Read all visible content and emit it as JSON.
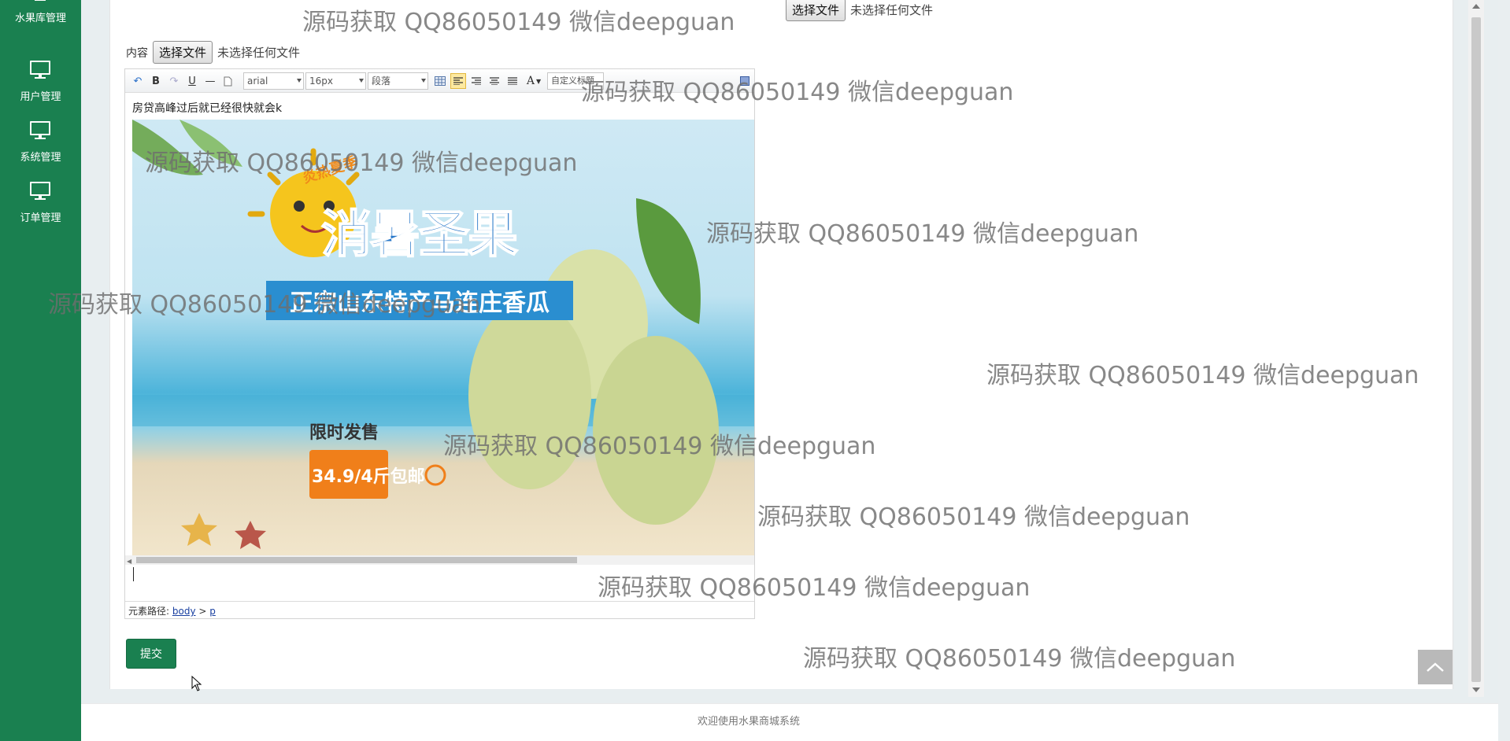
{
  "sidebar": {
    "items": [
      {
        "label": "水果库管理",
        "icon": "monitor-icon"
      },
      {
        "label": "用户管理",
        "icon": "monitor-icon"
      },
      {
        "label": "系统管理",
        "icon": "monitor-icon"
      },
      {
        "label": "订单管理",
        "icon": "monitor-icon"
      }
    ]
  },
  "form": {
    "top_file_button": "选择文件",
    "top_file_status": "未选择任何文件",
    "content_label": "内容",
    "content_file_button": "选择文件",
    "content_file_status": "未选择任何文件",
    "submit_label": "提交"
  },
  "editor": {
    "toolbar": {
      "font_family": "arial",
      "font_size": "16px",
      "paragraph": "段落",
      "custom_title": "自定义标题"
    },
    "body_text": "房贷高峰过后就已经很快就会k",
    "banner": {
      "tag": "炎热夏季",
      "headline": "消暑圣果",
      "subtitle": "正宗山东特产马连庄香瓜",
      "promo": "限时发售",
      "price": "34.9/4斤包邮"
    },
    "path_label": "元素路径:",
    "path_items": [
      "body",
      "p"
    ]
  },
  "footer": {
    "text": "欢迎使用水果商城系统"
  },
  "watermark": "源码获取 QQ86050149 微信deepguan",
  "colors": {
    "sidebar": "#1a8050",
    "submit": "#1a8050"
  }
}
